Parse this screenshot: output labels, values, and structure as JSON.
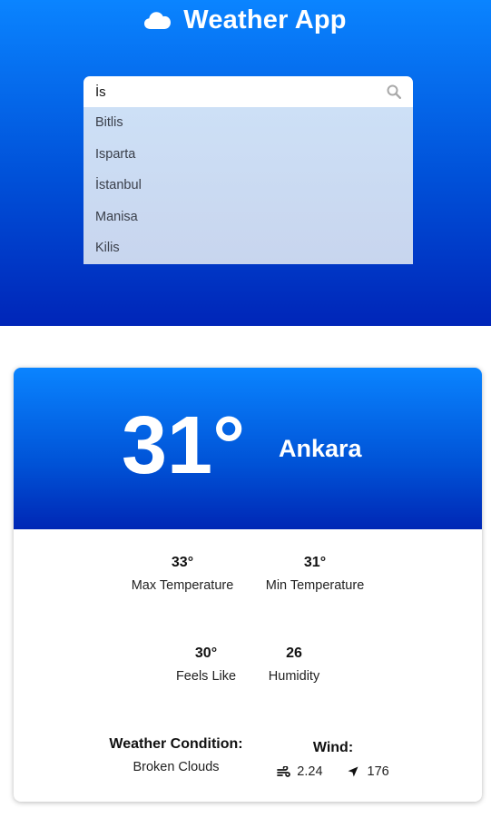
{
  "header": {
    "icon": "cloud-icon",
    "title": "Weather App"
  },
  "search": {
    "value": "İs",
    "icon": "search-icon",
    "suggestions": [
      "Bitlis",
      "Isparta",
      "İstanbul",
      "Manisa",
      "Kilis"
    ]
  },
  "current": {
    "temperature": "31°",
    "city": "Ankara"
  },
  "details": {
    "max_temp_value": "33°",
    "max_temp_label": "Max Temperature",
    "min_temp_value": "31°",
    "min_temp_label": "Min Temperature",
    "feels_like_value": "30°",
    "feels_like_label": "Feels Like",
    "humidity_value": "26",
    "humidity_label": "Humidity",
    "condition_title": "Weather Condition:",
    "condition_value": "Broken Clouds",
    "wind_title": "Wind:",
    "wind_speed": "2.24",
    "wind_speed_icon": "wind-icon",
    "wind_direction": "176",
    "wind_direction_icon": "navigation-arrow-icon"
  },
  "colors": {
    "gradient_top": "#0a84ff",
    "gradient_bottom": "#0027b5",
    "dropdown_bg": "#cde0f6"
  }
}
